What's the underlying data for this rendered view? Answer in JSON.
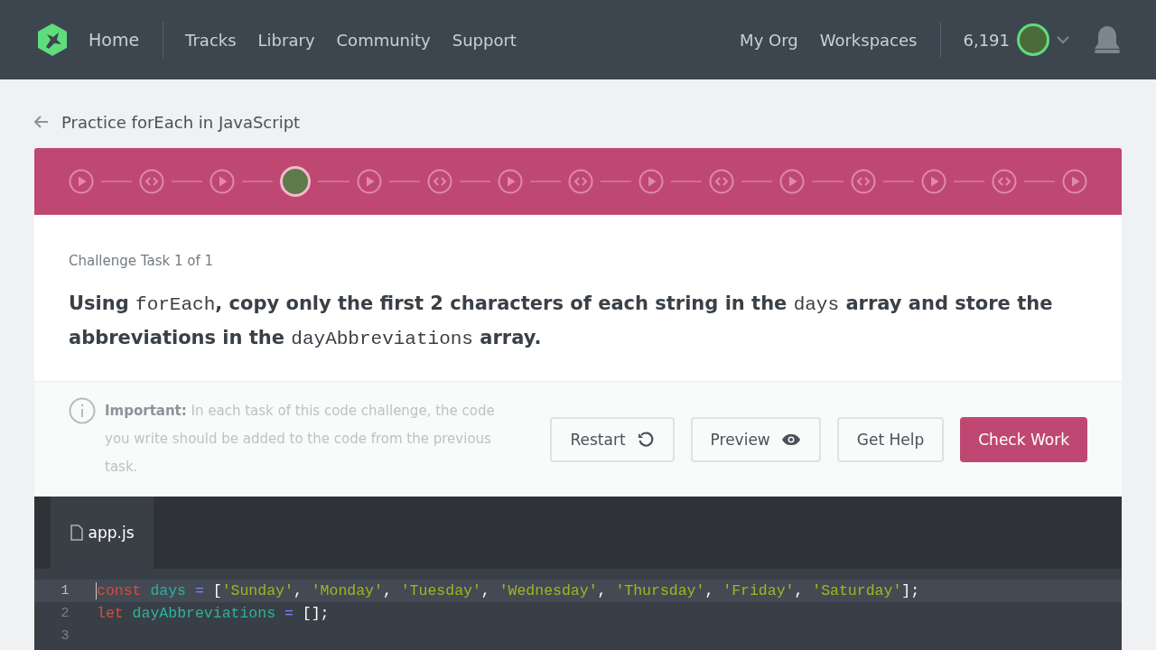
{
  "nav": {
    "home": "Home",
    "links": [
      "Tracks",
      "Library",
      "Community",
      "Support"
    ],
    "right_links": [
      "My Org",
      "Workspaces"
    ],
    "points": "6,191"
  },
  "breadcrumb": {
    "title": "Practice forEach in JavaScript"
  },
  "steps": [
    {
      "kind": "video"
    },
    {
      "kind": "code"
    },
    {
      "kind": "video"
    },
    {
      "kind": "current"
    },
    {
      "kind": "video"
    },
    {
      "kind": "code"
    },
    {
      "kind": "video"
    },
    {
      "kind": "code"
    },
    {
      "kind": "video"
    },
    {
      "kind": "code"
    },
    {
      "kind": "video"
    },
    {
      "kind": "code"
    },
    {
      "kind": "video"
    },
    {
      "kind": "code"
    },
    {
      "kind": "video"
    }
  ],
  "task": {
    "counter": "Challenge Task 1 of 1",
    "prompt": [
      {
        "kind": "text",
        "text": "Using "
      },
      {
        "kind": "code",
        "text": "forEach"
      },
      {
        "kind": "text",
        "text": ", copy only the first 2 characters of each string in the "
      },
      {
        "kind": "code",
        "text": "days"
      },
      {
        "kind": "text",
        "text": " array and store the abbreviations in the "
      },
      {
        "kind": "code",
        "text": "dayAbbreviations"
      },
      {
        "kind": "text",
        "text": " array."
      }
    ]
  },
  "notice": "**Important:** In each task of this code challenge, the code you write should be added to the code from the previous task.",
  "buttons": [
    {
      "label": "Restart",
      "kind": "restart"
    },
    {
      "label": "Preview",
      "kind": "preview"
    },
    {
      "label": "Get Help",
      "kind": "plain"
    },
    {
      "label": "Check Work",
      "kind": "primary"
    }
  ],
  "editor": {
    "tab": "app.js",
    "lines": [
      {
        "number": "1",
        "active": true,
        "tokens": [
          {
            "kind": "keyword",
            "text": "const"
          },
          {
            "kind": "ident",
            "text": " days "
          },
          {
            "kind": "op",
            "text": "= "
          },
          {
            "kind": "punct",
            "text": "["
          },
          {
            "kind": "string",
            "text": "'Sunday'"
          },
          {
            "kind": "punct",
            "text": ", "
          },
          {
            "kind": "string",
            "text": "'Monday'"
          },
          {
            "kind": "punct",
            "text": ", "
          },
          {
            "kind": "string",
            "text": "'Tuesday'"
          },
          {
            "kind": "punct",
            "text": ", "
          },
          {
            "kind": "string",
            "text": "'Wednesday'"
          },
          {
            "kind": "punct",
            "text": ", "
          },
          {
            "kind": "string",
            "text": "'Thursday'"
          },
          {
            "kind": "punct",
            "text": ", "
          },
          {
            "kind": "string",
            "text": "'Friday'"
          },
          {
            "kind": "punct",
            "text": ", "
          },
          {
            "kind": "string",
            "text": "'Saturday'"
          },
          {
            "kind": "punct",
            "text": "];"
          }
        ]
      },
      {
        "number": "2",
        "active": false,
        "tokens": [
          {
            "kind": "keyword",
            "text": "let"
          },
          {
            "kind": "ident",
            "text": " dayAbbreviations "
          },
          {
            "kind": "op",
            "text": "= "
          },
          {
            "kind": "punct",
            "text": "[];"
          }
        ]
      },
      {
        "number": "3",
        "active": false
      }
    ]
  }
}
